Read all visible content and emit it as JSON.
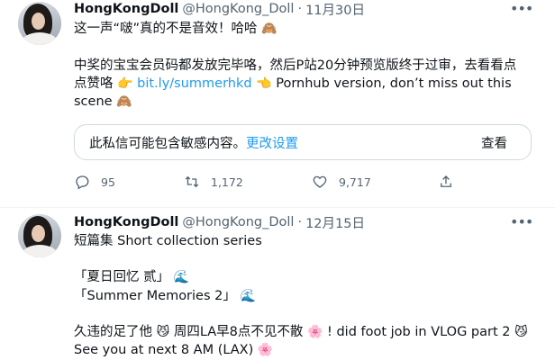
{
  "tweets": [
    {
      "author": "HongKongDoll",
      "handle": "@HongKong_Doll",
      "date": "11月30日",
      "lines": {
        "l1": "这一声“啵”真的不是音效！哈哈",
        "l2": "中奖的宝宝会员码都发放完毕咯，然后P站20分钟预览版终于过审，去看看点",
        "l3a": "点赞咯",
        "l3link": "bit.ly/summerhkd",
        "l3b": "Pornhub version, don’t miss out this",
        "l4": "scene"
      },
      "sensitive_warning": {
        "text": "此私信可能包含敏感内容。",
        "link": "更改设置",
        "view": "查看"
      },
      "actions": {
        "replies": "95",
        "retweets": "1,172",
        "likes": "9,717"
      }
    },
    {
      "author": "HongKongDoll",
      "handle": "@HongKong_Doll",
      "date": "12月15日",
      "lines": {
        "l1": "短篇集 Short collection series",
        "l2": "「夏日回忆 贰」",
        "l3": "「Summer Memories 2」",
        "l4a": "久违的足了他",
        "l4b": "周四LA早8点不见不散",
        "l4c": "! did foot job in VLOG part 2",
        "l5": "See you at next 8 AM (LAX)"
      }
    }
  ],
  "icons": {
    "more": "more-horizontal-icon",
    "emoji_monkey": "🙈",
    "emoji_hand_right": "👉",
    "emoji_hand_left": "👈",
    "emoji_wave": "🌊",
    "emoji_smirk": "😼",
    "emoji_blossom": "🌸"
  },
  "colors": {
    "link": "#1d9bf0",
    "muted": "#536471",
    "text": "#0f1419",
    "border": "#cfd9de"
  }
}
